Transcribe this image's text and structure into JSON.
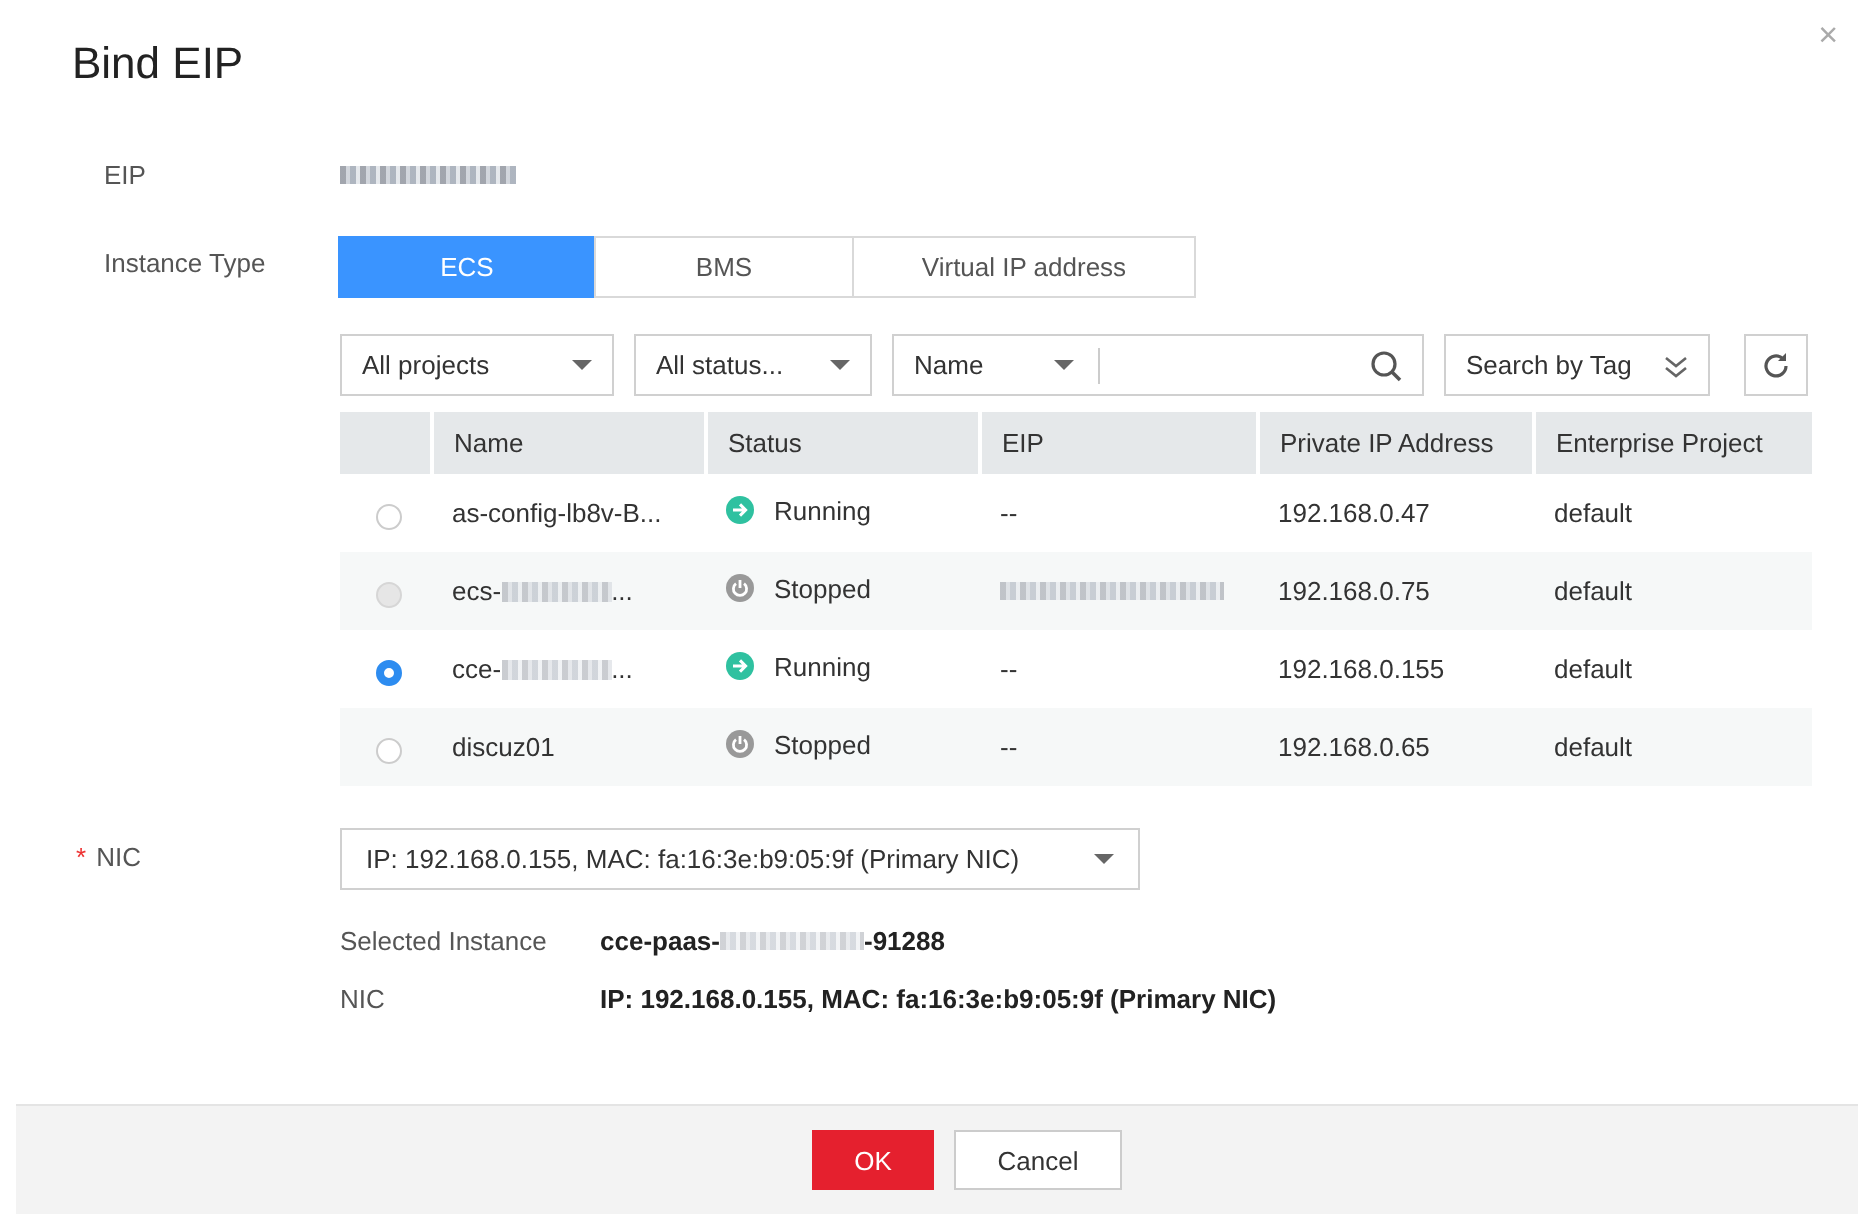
{
  "dialog": {
    "title": "Bind EIP",
    "close": "×"
  },
  "eip": {
    "label": "EIP",
    "value_redacted": true
  },
  "instance_type": {
    "label": "Instance Type",
    "options": [
      {
        "label": "ECS",
        "selected": true
      },
      {
        "label": "BMS",
        "selected": false
      },
      {
        "label": "Virtual IP address",
        "selected": false
      }
    ]
  },
  "filters": {
    "project": "All projects",
    "status": "All status...",
    "search_field": "Name",
    "tag_button": "Search by Tag"
  },
  "table": {
    "columns": [
      "Name",
      "Status",
      "EIP",
      "Private IP Address",
      "Enterprise Project"
    ],
    "rows": [
      {
        "selected": false,
        "disabled": false,
        "name": "as-config-lb8v-B...",
        "name_redacted": false,
        "status": "Running",
        "kind": "running",
        "eip": "--",
        "eip_redacted": false,
        "private_ip": "192.168.0.47",
        "project": "default"
      },
      {
        "selected": false,
        "disabled": true,
        "name": "ecs-",
        "name_redacted": true,
        "name_suffix": "...",
        "status": "Stopped",
        "kind": "stopped",
        "eip_redacted": true,
        "private_ip": "192.168.0.75",
        "project": "default"
      },
      {
        "selected": true,
        "disabled": false,
        "name": "cce-",
        "name_redacted": true,
        "name_suffix": "...",
        "status": "Running",
        "kind": "running",
        "eip": "--",
        "eip_redacted": false,
        "private_ip": "192.168.0.155",
        "project": "default"
      },
      {
        "selected": false,
        "disabled": false,
        "name": "discuz01",
        "name_redacted": false,
        "status": "Stopped",
        "kind": "stopped",
        "eip": "--",
        "eip_redacted": false,
        "private_ip": "192.168.0.65",
        "project": "default"
      }
    ]
  },
  "nic": {
    "label": "NIC",
    "required_mark": "*",
    "value": "IP: 192.168.0.155, MAC: fa:16:3e:b9:05:9f (Primary NIC)"
  },
  "summary": [
    {
      "label": "Selected Instance",
      "value": "cce-paas-",
      "redacted": true,
      "value_suffix": "-91288"
    },
    {
      "label": "NIC",
      "value": "IP: 192.168.0.155, MAC: fa:16:3e:b9:05:9f (Primary NIC)",
      "redacted": false
    }
  ],
  "buttons": {
    "ok": "OK",
    "cancel": "Cancel"
  }
}
